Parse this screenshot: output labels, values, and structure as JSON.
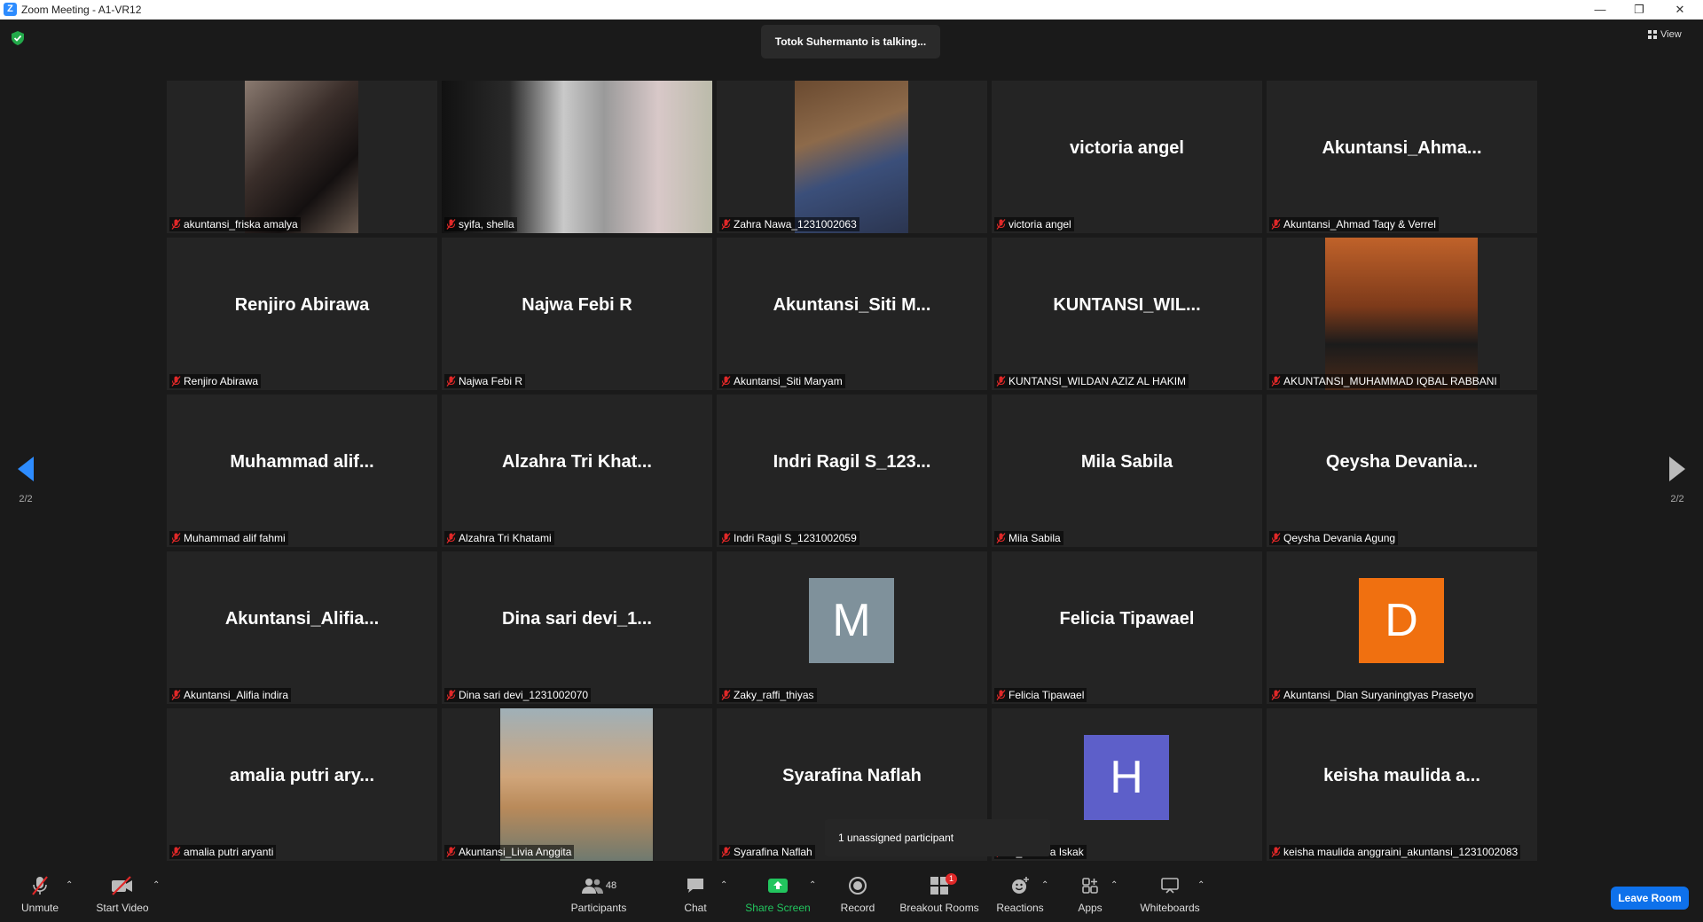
{
  "window": {
    "title": "Zoom Meeting - A1-VR12",
    "logo": "Z"
  },
  "talking_indicator": "Totok Suhermanto is talking...",
  "view_button": "View",
  "pager": {
    "left": "2/2",
    "right": "2/2"
  },
  "colors": {
    "accent": "#2d8cff",
    "leave": "#0e71eb",
    "muted": "#e02828",
    "share_green": "#22c55e"
  },
  "tiles": [
    {
      "label": "akuntansi_friska amalya",
      "display": "",
      "kind": "video"
    },
    {
      "label": "syifa, shella",
      "display": "",
      "kind": "video"
    },
    {
      "label": "Zahra Nawa_1231002063",
      "display": "",
      "kind": "video"
    },
    {
      "label": "victoria angel",
      "display": "victoria angel",
      "kind": "name"
    },
    {
      "label": "Akuntansi_Ahmad Taqy & Verrel",
      "display": "Akuntansi_Ahma...",
      "kind": "name"
    },
    {
      "label": "Renjiro Abirawa",
      "display": "Renjiro Abirawa",
      "kind": "name"
    },
    {
      "label": "Najwa Febi R",
      "display": "Najwa Febi R",
      "kind": "name"
    },
    {
      "label": "Akuntansi_Siti Maryam",
      "display": "Akuntansi_Siti M...",
      "kind": "name"
    },
    {
      "label": "KUNTANSI_WILDAN AZIZ AL HAKIM",
      "display": "KUNTANSI_WIL...",
      "kind": "name"
    },
    {
      "label": "AKUNTANSI_MUHAMMAD IQBAL RABBANI",
      "display": "",
      "kind": "video"
    },
    {
      "label": "Muhammad alif fahmi",
      "display": "Muhammad alif...",
      "kind": "name"
    },
    {
      "label": "Alzahra Tri Khatami",
      "display": "Alzahra Tri Khat...",
      "kind": "name"
    },
    {
      "label": "Indri Ragil S_1231002059",
      "display": "Indri Ragil S_123...",
      "kind": "name"
    },
    {
      "label": "Mila Sabila",
      "display": "Mila Sabila",
      "kind": "name"
    },
    {
      "label": "Qeysha Devania Agung",
      "display": "Qeysha Devania...",
      "kind": "name"
    },
    {
      "label": "Akuntansi_Alifia indira",
      "display": "Akuntansi_Alifia...",
      "kind": "name"
    },
    {
      "label": "Dina sari devi_1231002070",
      "display": "Dina sari devi_1...",
      "kind": "name"
    },
    {
      "label": "Zaky_raffi_thiyas",
      "display": "M",
      "kind": "avatar",
      "color": "#7f919b"
    },
    {
      "label": "Felicia Tipawael",
      "display": "Felicia Tipawael",
      "kind": "name"
    },
    {
      "label": "Akuntansi_Dian Suryaningtyas Prasetyo",
      "display": "D",
      "kind": "avatar",
      "color": "#f07010"
    },
    {
      "label": "amalia putri aryanti",
      "display": "amalia putri ary...",
      "kind": "name"
    },
    {
      "label": "Akuntansi_Livia Anggita",
      "display": "",
      "kind": "video"
    },
    {
      "label": "Syarafina Naflah",
      "display": "Syarafina Naflah",
      "kind": "name"
    },
    {
      "label": "si_Helena Iskak",
      "display": "H",
      "kind": "avatar",
      "color": "#5d5fc9"
    },
    {
      "label": "keisha maulida anggraini_akuntansi_1231002083",
      "display": "keisha maulida a...",
      "kind": "name"
    }
  ],
  "unassigned_tooltip": "1 unassigned participant",
  "toolbar": {
    "unmute": "Unmute",
    "start_video": "Start Video",
    "participants": "Participants",
    "participants_count": "48",
    "chat": "Chat",
    "share_screen": "Share Screen",
    "record": "Record",
    "breakout_rooms": "Breakout Rooms",
    "breakout_badge": "1",
    "reactions": "Reactions",
    "apps": "Apps",
    "whiteboards": "Whiteboards",
    "leave": "Leave Room"
  },
  "icons": [
    "shield-icon",
    "grid-view-icon",
    "mic-muted-icon",
    "video-off-icon",
    "participants-icon",
    "chat-icon",
    "share-screen-icon",
    "record-icon",
    "breakout-rooms-icon",
    "reactions-icon",
    "apps-icon",
    "whiteboard-icon",
    "chevron-up-icon",
    "arrow-left-icon",
    "arrow-right-icon"
  ]
}
